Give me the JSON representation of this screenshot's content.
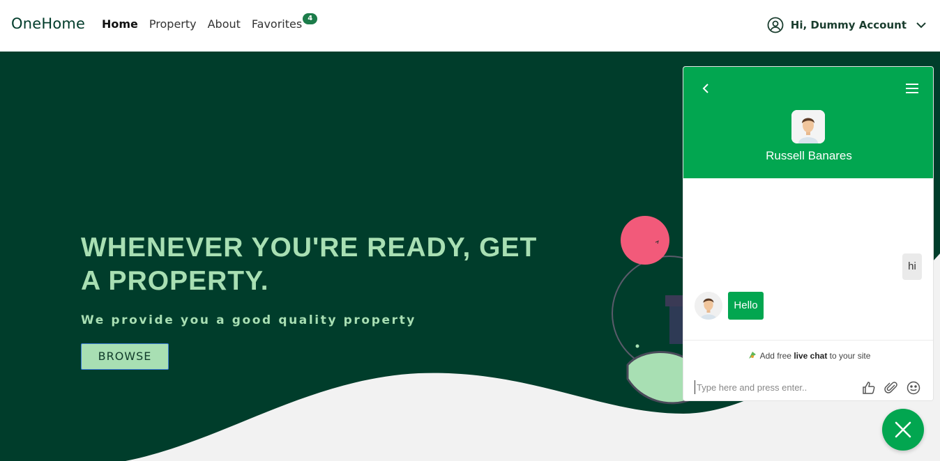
{
  "navbar": {
    "brand": "OneHome",
    "links": [
      {
        "label": "Home"
      },
      {
        "label": "Property"
      },
      {
        "label": "About"
      },
      {
        "label": "Favorites"
      }
    ],
    "favorites_count": "4",
    "user_greeting": "Hi, Dummy Account"
  },
  "hero": {
    "title_line1": "WHENEVER YOU'RE READY, GET",
    "title_line2": "A PROPERTY.",
    "subtitle": "We provide you a good quality property",
    "browse_label": "BROWSE"
  },
  "chat": {
    "agent_name": "Russell Banares",
    "messages": [
      {
        "from": "me",
        "text": "hi"
      },
      {
        "from": "agent",
        "text": "Hello"
      }
    ],
    "powered_prefix": "Add free ",
    "powered_bold": "live chat",
    "powered_suffix": " to your site",
    "input_placeholder": "Type here and press enter.."
  },
  "colors": {
    "hero_bg": "#003d2b",
    "accent_green": "#02a650",
    "hero_text": "#a8dfb3",
    "badge": "#1c7c4a"
  }
}
